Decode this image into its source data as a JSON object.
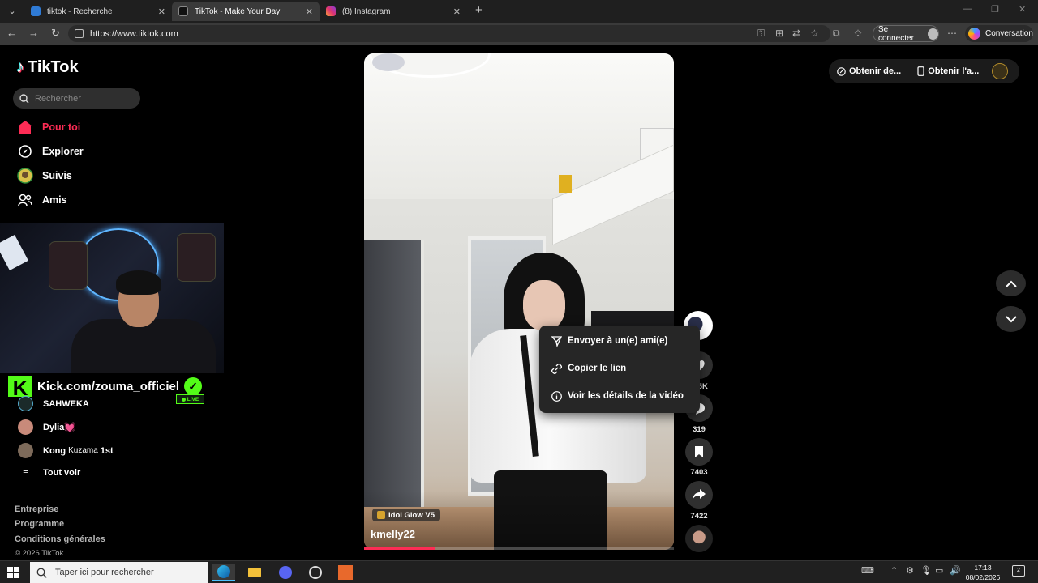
{
  "browser": {
    "tabs": [
      {
        "title": "tiktok - Recherche",
        "icon": "bing-icon",
        "active": false
      },
      {
        "title": "TikTok - Make Your Day",
        "icon": "tiktok-icon",
        "active": true
      },
      {
        "title": "(8) Instagram",
        "icon": "instagram-icon",
        "active": false
      }
    ],
    "url": "https://www.tiktok.com",
    "signin_label": "Se connecter",
    "copilot_label": "Conversation"
  },
  "tiktok": {
    "brand": "TikTok",
    "search_placeholder": "Rechercher",
    "nav": [
      {
        "label": "Pour toi",
        "icon": "home-icon",
        "active": true
      },
      {
        "label": "Explorer",
        "icon": "compass-icon",
        "active": false
      },
      {
        "label": "Suivis",
        "icon": "following-icon",
        "active": false
      },
      {
        "label": "Amis",
        "icon": "friends-icon",
        "active": false
      }
    ],
    "following_accounts": [
      {
        "name": "SAHWEKA",
        "suffix": ""
      },
      {
        "name": "Dylia",
        "suffix": "💓"
      },
      {
        "name": "Kong",
        "sub": "Kuzama",
        "suffix": "1st"
      }
    ],
    "see_all": "Tout voir",
    "footer": [
      "Entreprise",
      "Programme",
      "Conditions générales"
    ],
    "copyright": "© 2026 TikTok",
    "header_buttons": [
      "Obtenir de...",
      "Obtenir l'a..."
    ]
  },
  "overlay": {
    "kick_text": "Kick.com/zouma_officiel",
    "live_badge": "LIVE"
  },
  "video": {
    "username": "kmelly22",
    "effect_label": "Idol Glow V5",
    "progress": 0.23,
    "actions": [
      {
        "name": "like",
        "icon": "heart-icon",
        "count": "…5K"
      },
      {
        "name": "comment",
        "icon": "comment-icon",
        "count": "319"
      },
      {
        "name": "favorite",
        "icon": "bookmark-icon",
        "count": "7403"
      },
      {
        "name": "share",
        "icon": "share-icon",
        "count": "7422"
      }
    ]
  },
  "share_menu": [
    {
      "label": "Envoyer à un(e) ami(e)",
      "icon": "send-icon"
    },
    {
      "label": "Copier le lien",
      "icon": "link-icon"
    },
    {
      "label": "Voir les détails de la vidéo",
      "icon": "info-icon"
    }
  ],
  "taskbar": {
    "search_placeholder": "Taper ici pour rechercher",
    "time": "17:13",
    "date": "08/02/2026",
    "notification_count": "2"
  },
  "colors": {
    "accent": "#fe2c55",
    "kick_green": "#53fc18",
    "edge_blue": "#4cc2ff"
  }
}
